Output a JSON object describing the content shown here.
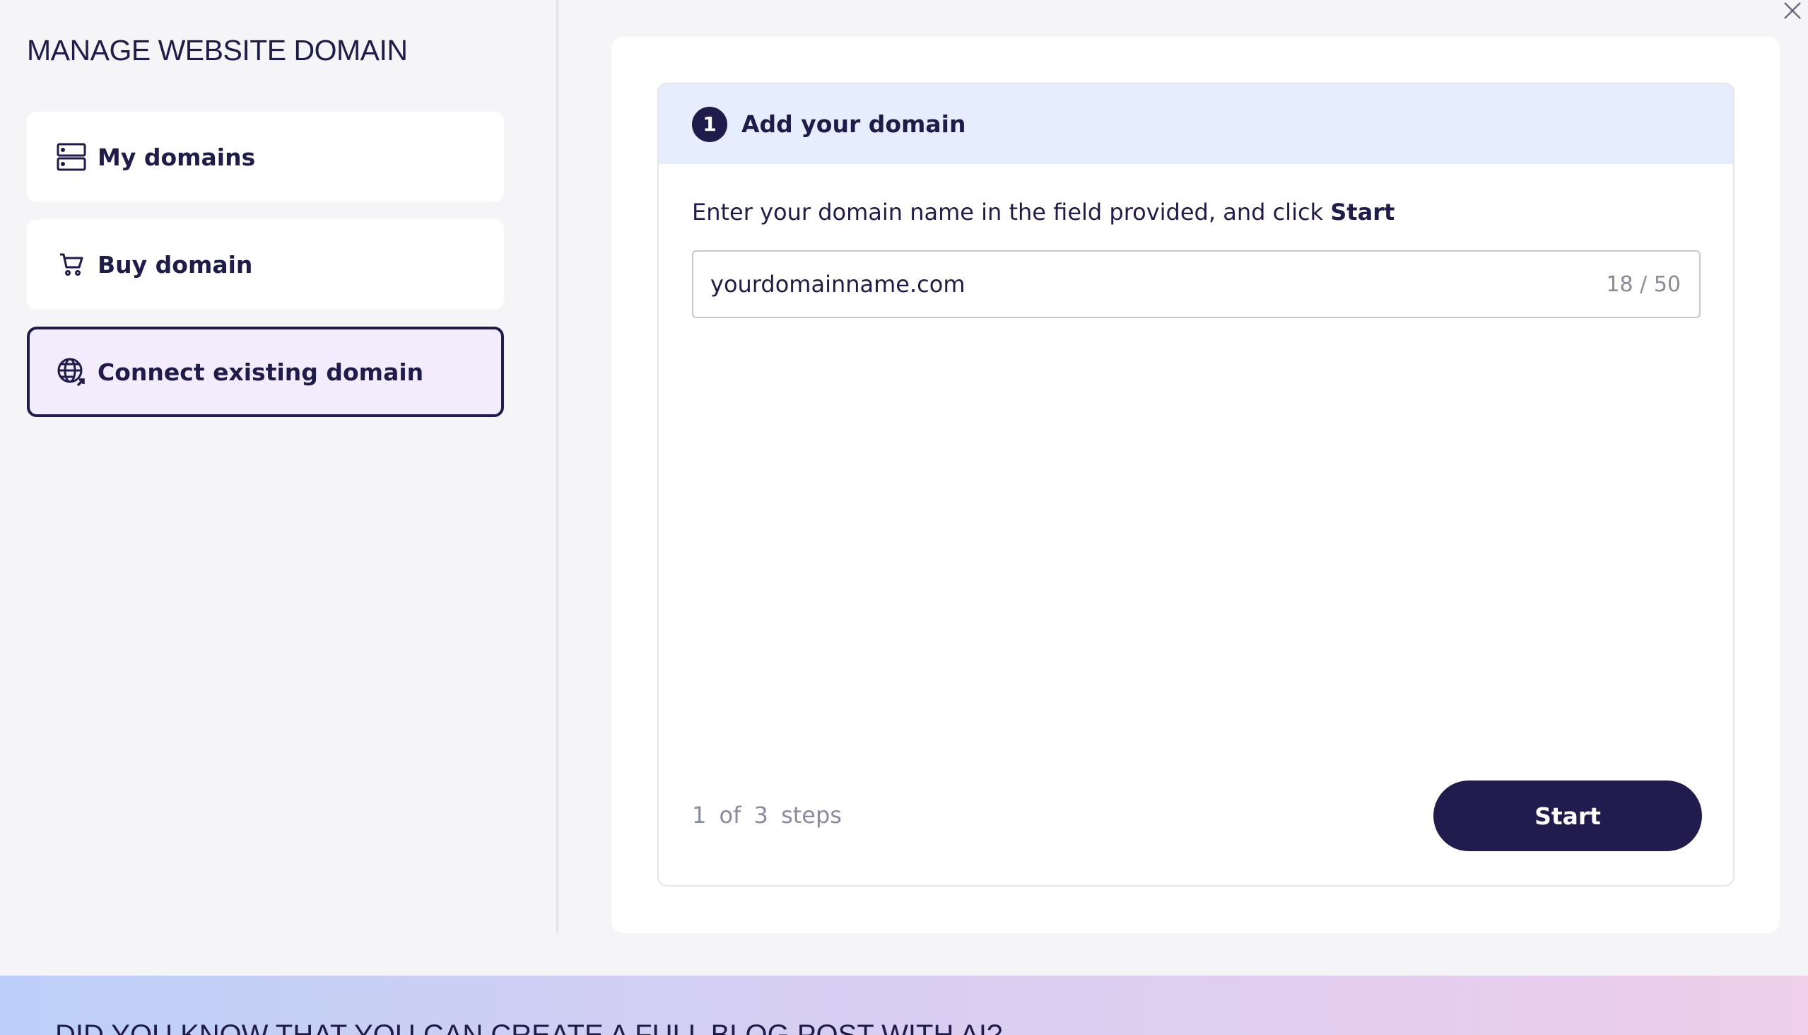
{
  "sidebar": {
    "title": "MANAGE WEBSITE DOMAIN",
    "items": [
      {
        "label": "My domains",
        "icon": "server-icon",
        "selected": false
      },
      {
        "label": "Buy domain",
        "icon": "cart-icon",
        "selected": false
      },
      {
        "label": "Connect existing domain",
        "icon": "globe-link-icon",
        "selected": true
      }
    ]
  },
  "dialog": {
    "close_icon": "close-icon"
  },
  "step": {
    "number": "1",
    "title": "Add your domain",
    "instruction_prefix": "Enter your domain name in the field provided, and click ",
    "instruction_bold": "Start",
    "input_value": "yourdomainname.com",
    "char_count": "18 / 50",
    "progress": "1 of 3 steps",
    "start_label": "Start"
  },
  "banner": {
    "text": "DID YOU KNOW THAT YOU CAN CREATE A FULL BLOG POST WITH AI?"
  },
  "colors": {
    "primary": "#1f1b4a",
    "header_bg": "#e6edfd",
    "selected_bg": "#f3ecfc",
    "page_bg": "#f5f5f7"
  }
}
